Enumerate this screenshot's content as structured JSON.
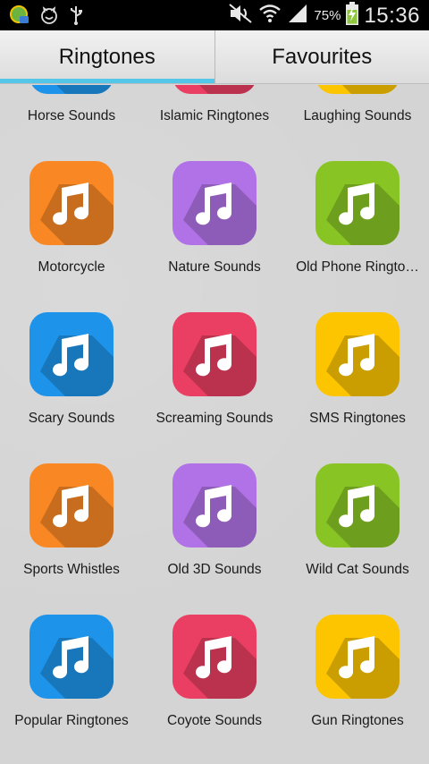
{
  "status_bar": {
    "battery_percent": "75%",
    "time": "15:36",
    "icons": [
      "app-notification-icon",
      "cat-face-icon",
      "usb-icon",
      "mute-icon",
      "wifi-icon",
      "signal-icon",
      "battery-charging-icon"
    ]
  },
  "tabs": [
    {
      "label": "Ringtones",
      "active": true
    },
    {
      "label": "Favourites",
      "active": false
    }
  ],
  "colors": {
    "blue": "#1e93ea",
    "red": "#ea3f63",
    "yellow": "#fdc400",
    "orange": "#f98824",
    "purple": "#b072e6",
    "green": "#88c524",
    "tab_indicator": "#54c7e8"
  },
  "categories": [
    {
      "label": "Horse Sounds",
      "color": "blue"
    },
    {
      "label": "Islamic Ringtones",
      "color": "red"
    },
    {
      "label": "Laughing Sounds",
      "color": "yellow"
    },
    {
      "label": "Motorcycle",
      "color": "orange"
    },
    {
      "label": "Nature Sounds",
      "color": "purple"
    },
    {
      "label": "Old Phone Ringto…",
      "color": "green"
    },
    {
      "label": "Scary Sounds",
      "color": "blue"
    },
    {
      "label": "Screaming Sounds",
      "color": "red"
    },
    {
      "label": "SMS Ringtones",
      "color": "yellow"
    },
    {
      "label": "Sports Whistles",
      "color": "orange"
    },
    {
      "label": "Old 3D Sounds",
      "color": "purple"
    },
    {
      "label": "Wild Cat Sounds",
      "color": "green"
    },
    {
      "label": "Popular Ringtones",
      "color": "blue"
    },
    {
      "label": "Coyote Sounds",
      "color": "red"
    },
    {
      "label": "Gun Ringtones",
      "color": "yellow"
    }
  ]
}
